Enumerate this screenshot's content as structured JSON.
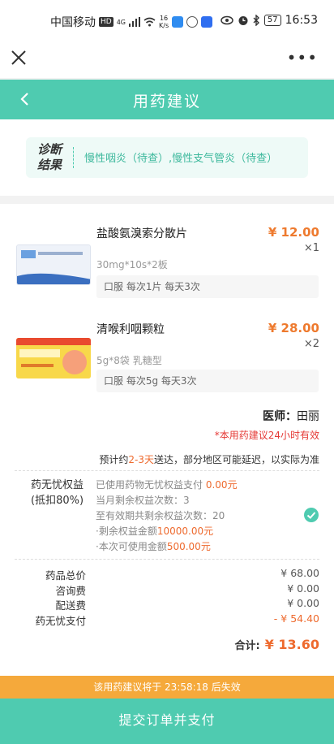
{
  "status_bar": {
    "carrier": "中国移动",
    "hd": "HD",
    "network": "4G",
    "speed_value": "16",
    "speed_unit": "K/s",
    "battery": "57",
    "time": "16:53"
  },
  "header": {
    "title": "用药建议"
  },
  "diagnosis": {
    "label": "诊断结果",
    "text": "慢性咽炎（待查）,慢性支气管炎（待查）"
  },
  "drugs": [
    {
      "name": "盐酸氨溴索分散片",
      "price": "¥ 12.00",
      "qty": "×1",
      "spec": "30mg*10s*2板",
      "usage": "口服 每次1片 每天3次"
    },
    {
      "name": "清喉利咽颗粒",
      "price": "¥ 28.00",
      "qty": "×2",
      "spec": "5g*8袋 乳糖型",
      "usage": "口服 每次5g 每天3次"
    }
  ],
  "doctor": {
    "label": "医师：",
    "name": "田丽"
  },
  "valid_note": "*本用药建议24小时有效",
  "delivery": {
    "prefix": "预计约",
    "days": "2-3天",
    "suffix": "送达，部分地区可能延迟，以实际为准"
  },
  "benefit": {
    "label_line1": "药无忧权益",
    "label_line2": "(抵扣80%)",
    "used_prefix": "已使用药物无忧权益支付",
    "used_amount": "0.00元",
    "month_remaining": "当月剩余权益次数：3",
    "total_remaining": "至有效期共剩余权益次数：20",
    "remaining_amount_prefix": "·剩余权益金额",
    "remaining_amount": "10000.00元",
    "usable_prefix": "·本次可使用金额",
    "usable_amount": "500.00元"
  },
  "fees": [
    {
      "label": "药品总价",
      "value": "¥ 68.00"
    },
    {
      "label": "咨询费",
      "value": "¥ 0.00"
    },
    {
      "label": "配送费",
      "value": "¥ 0.00"
    },
    {
      "label": "药无忧支付",
      "value": "- ¥ 54.40"
    }
  ],
  "total": {
    "label": "合计:",
    "amount": "¥ 13.60"
  },
  "expiry_bar": "该用药建议将于 23:58:18 后失效",
  "submit_label": "提交订单并支付",
  "colors": {
    "accent": "#4fcbb0",
    "price": "#ee7a2e",
    "warning": "#e53935",
    "expiry": "#f5a93b"
  }
}
